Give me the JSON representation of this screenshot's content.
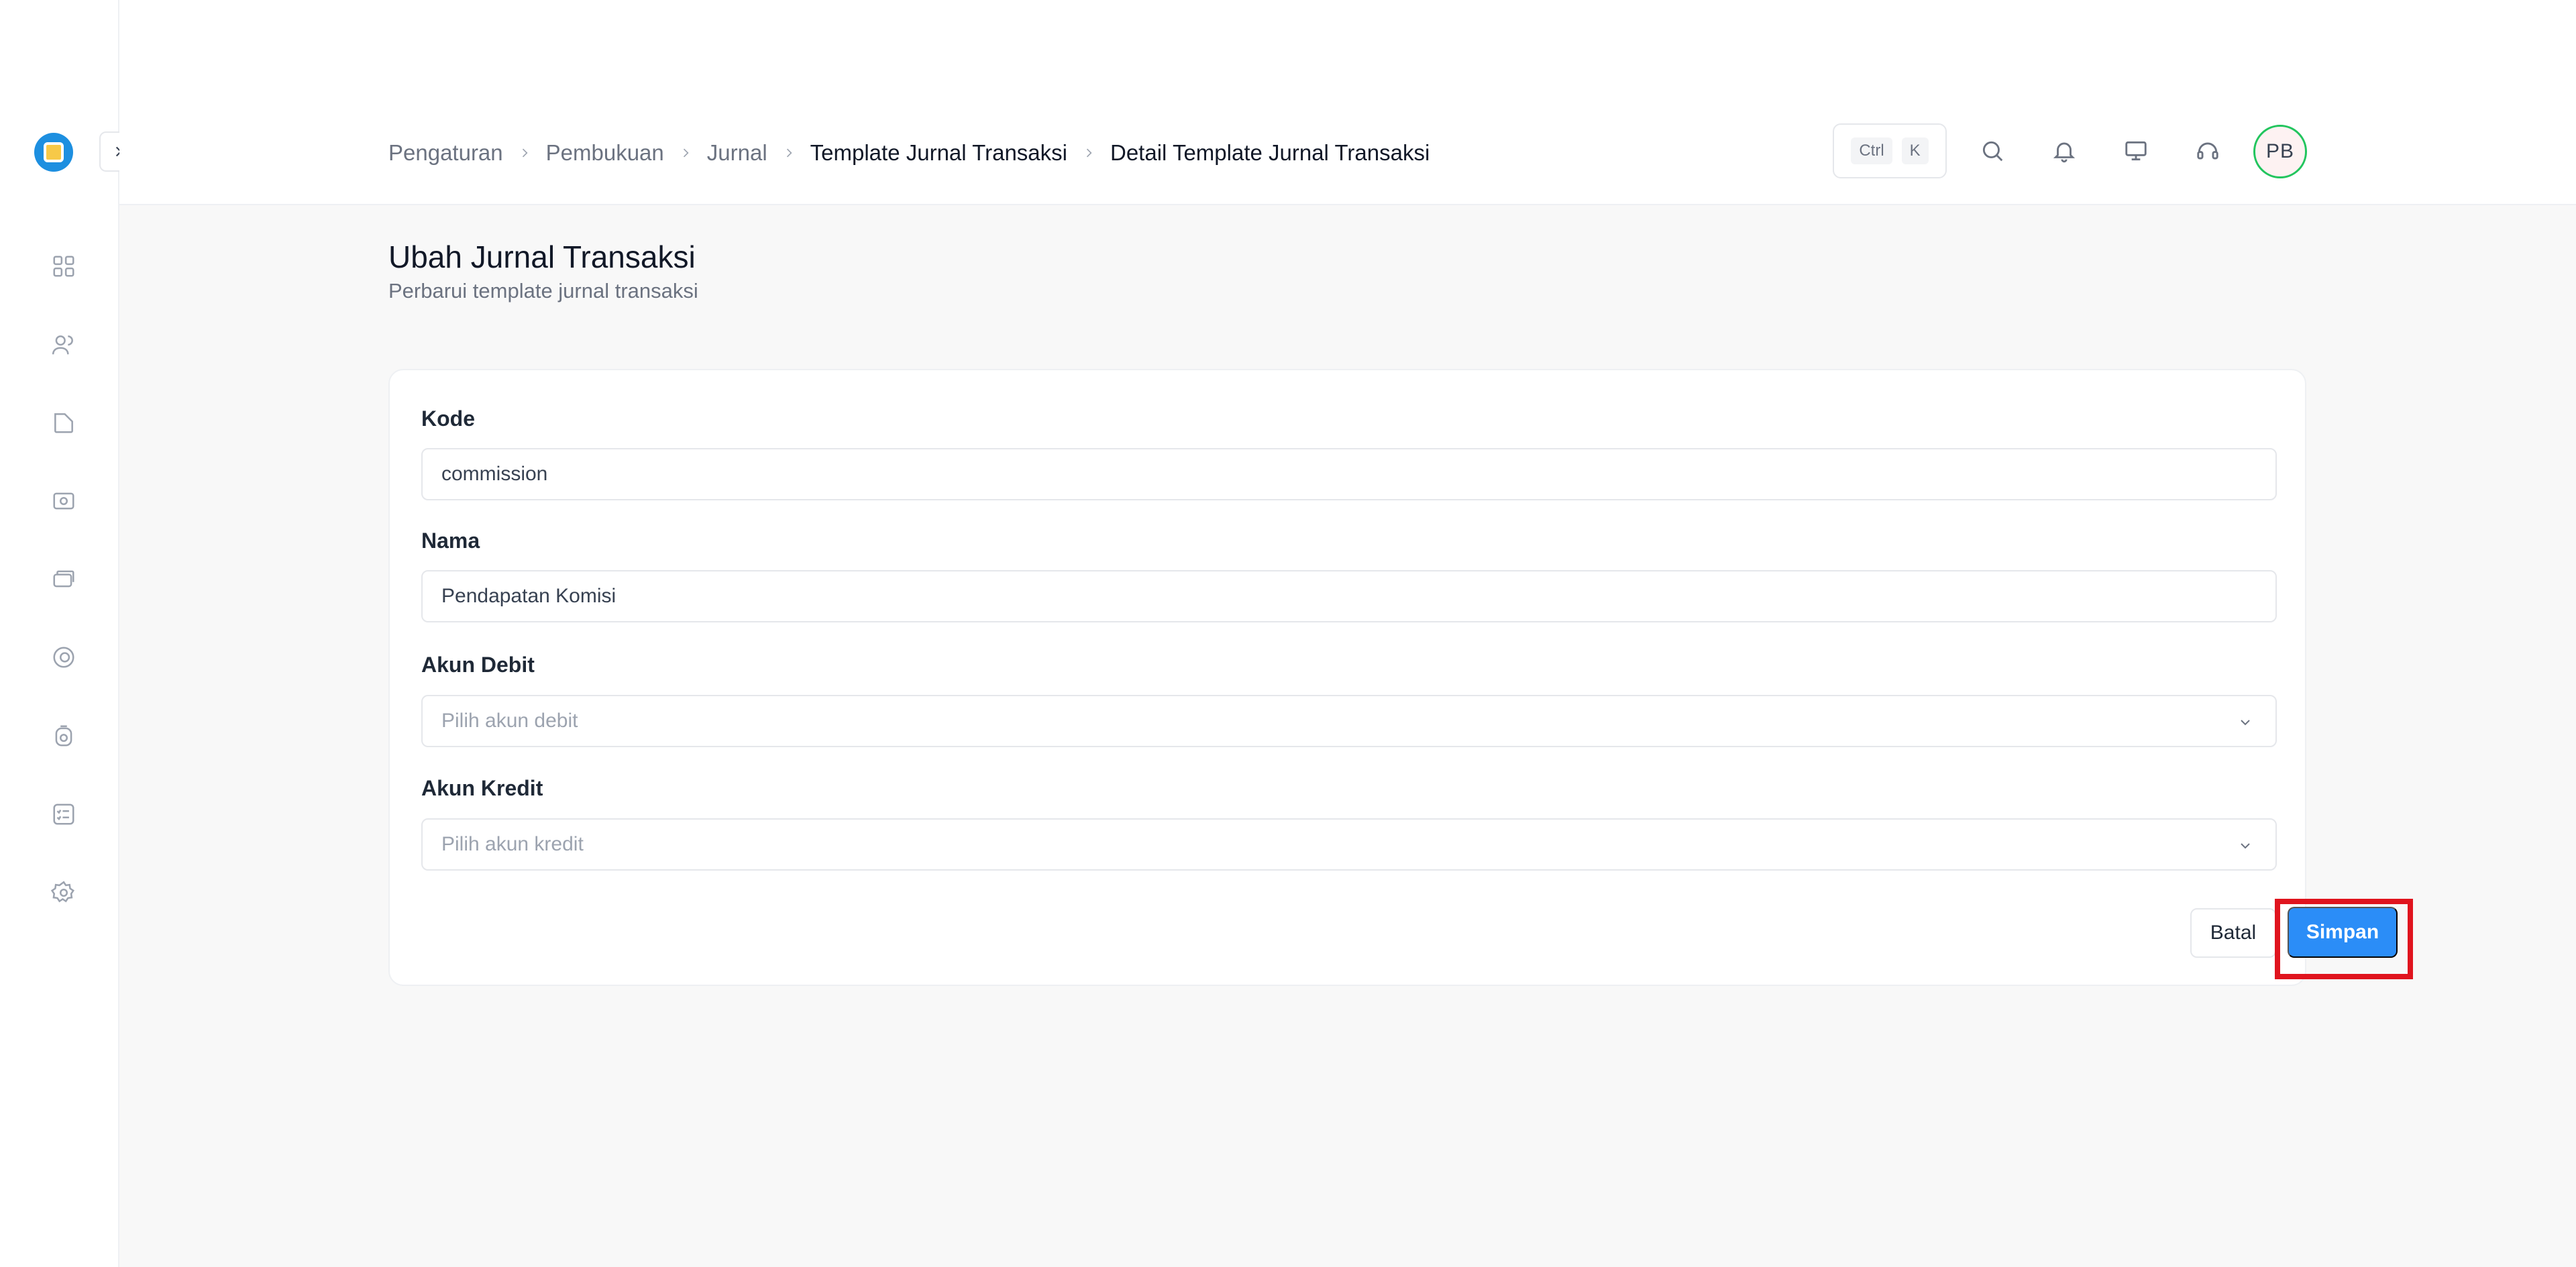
{
  "breadcrumb": {
    "items": [
      "Pengaturan",
      "Pembukuan",
      "Jurnal",
      "Template Jurnal Transaksi",
      "Detail Template Jurnal Transaksi"
    ]
  },
  "header": {
    "kbd_ctrl": "Ctrl",
    "kbd_k": "K",
    "avatar_initials": "PB"
  },
  "sidebar": {
    "nav_icons": [
      "dashboard-grid-icon",
      "users-icon",
      "folder-icon",
      "camera-money-icon",
      "card-stack-icon",
      "badge-icon",
      "settings-coin-icon",
      "checklist-icon",
      "gear-icon"
    ]
  },
  "page": {
    "title": "Ubah Jurnal Transaksi",
    "subtitle": "Perbarui template jurnal transaksi"
  },
  "form": {
    "kode_label": "Kode",
    "kode_value": "commission",
    "nama_label": "Nama",
    "nama_value": "Pendapatan Komisi",
    "debit_label": "Akun Debit",
    "debit_placeholder": "Pilih akun debit",
    "kredit_label": "Akun Kredit",
    "kredit_placeholder": "Pilih akun kredit",
    "cancel_label": "Batal",
    "save_label": "Simpan"
  },
  "colors": {
    "primary": "#2b8df7",
    "highlight": "#e0141e",
    "avatar_ring": "#22c55e"
  }
}
